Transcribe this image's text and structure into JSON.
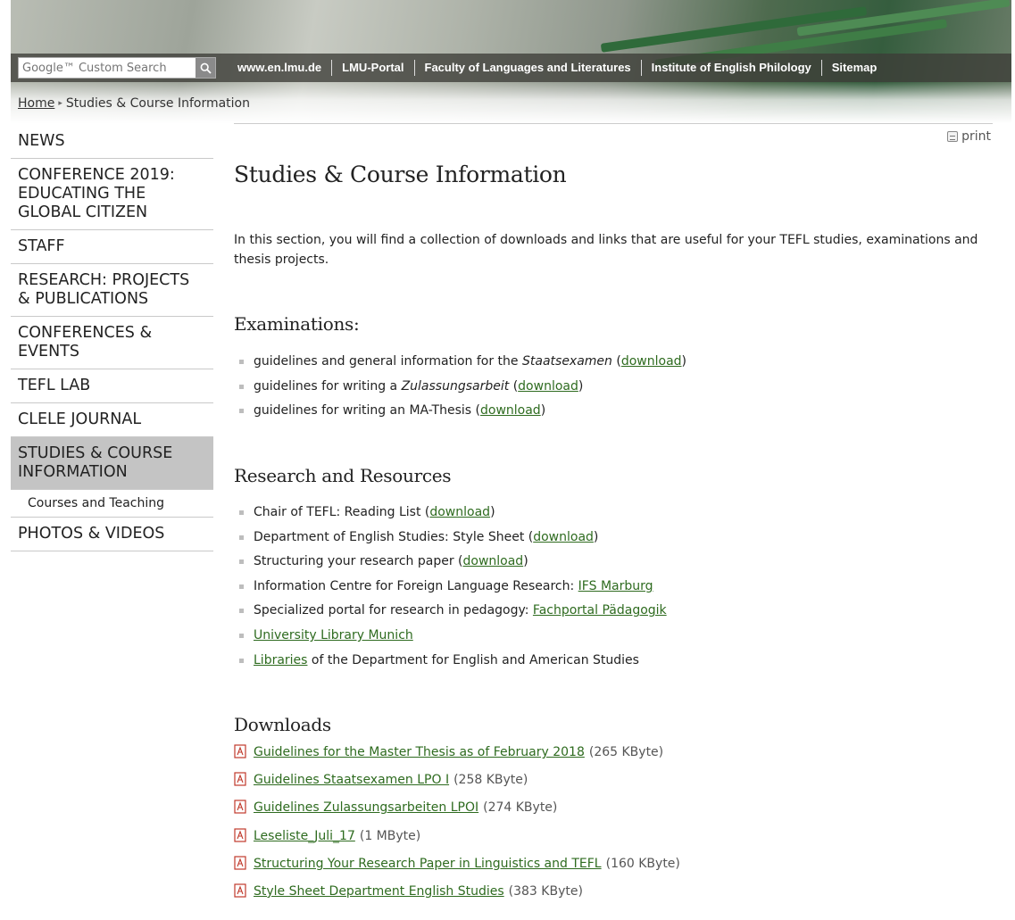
{
  "search": {
    "placeholder": "Google™ Custom Search"
  },
  "toplinks": [
    "www.en.lmu.de",
    "LMU-Portal",
    "Faculty of Languages and Literatures",
    "Institute of English Philology",
    "Sitemap"
  ],
  "breadcrumb": {
    "home": "Home",
    "current": "Studies & Course Information"
  },
  "sidebar": {
    "items": [
      {
        "label": "NEWS"
      },
      {
        "label": "CONFERENCE 2019: EDUCATING THE GLOBAL CITIZEN"
      },
      {
        "label": "STAFF"
      },
      {
        "label": "RESEARCH: PROJECTS & PUBLICATIONS"
      },
      {
        "label": "CONFERENCES & EVENTS"
      },
      {
        "label": "TEFL LAB"
      },
      {
        "label": "CLELE JOURNAL"
      },
      {
        "label": "STUDIES & COURSE INFORMATION"
      },
      {
        "label": "PHOTOS & VIDEOS"
      }
    ],
    "subitem": "Courses and Teaching"
  },
  "print_label": "print",
  "title": "Studies & Course Information",
  "intro": "In this section, you will find a collection of downloads and links that are useful for your TEFL studies, examinations and thesis projects.",
  "examinations": {
    "heading": "Examinations:",
    "items": [
      {
        "pre": "guidelines and general information for the ",
        "em": "Staatsexamen",
        "post": " (",
        "link": "download",
        "end": ")"
      },
      {
        "pre": "guidelines for writing a ",
        "em": "Zulassungsarbeit",
        "post": " (",
        "link": "download",
        "end": ")"
      },
      {
        "pre": "guidelines for writing an MA-Thesis (",
        "em": "",
        "post": "",
        "link": "download",
        "end": ")"
      }
    ]
  },
  "research": {
    "heading": "Research and Resources",
    "items": [
      {
        "pre": "Chair of TEFL: Reading List (",
        "link": "download",
        "post": ")"
      },
      {
        "pre": "Department of English Studies: Style Sheet (",
        "link": "download",
        "post": ")"
      },
      {
        "pre": "Structuring your research paper (",
        "link": "download",
        "post": ")"
      },
      {
        "pre": "Information Centre for Foreign Language Research: ",
        "link": "IFS Marburg",
        "post": ""
      },
      {
        "pre": "Specialized portal for research in pedagogy: ",
        "link": "Fachportal Pädagogik",
        "post": ""
      },
      {
        "pre": "",
        "link": "University Library Munich",
        "post": ""
      },
      {
        "pre": "",
        "link": "Libraries",
        "post": " of the Department for English and American Studies"
      }
    ]
  },
  "downloads": {
    "heading": "Downloads",
    "items": [
      {
        "title": "Guidelines for the Master Thesis as of February 2018",
        "size": "(265 KByte)"
      },
      {
        "title": "Guidelines Staatsexamen LPO I",
        "size": "(258 KByte)"
      },
      {
        "title": "Guidelines Zulassungsarbeiten LPOI",
        "size": "(274 KByte)"
      },
      {
        "title": "Leseliste_Juli_17",
        "size": "(1 MByte)"
      },
      {
        "title": "Structuring Your Research Paper in Linguistics and TEFL",
        "size": "(160 KByte)"
      },
      {
        "title": "Style Sheet Department English Studies",
        "size": "(383 KByte)"
      }
    ]
  },
  "colors": {
    "link": "#2e6b1f",
    "active_nav": "#c4c4c4",
    "pdf_icon": "#c0392b"
  }
}
